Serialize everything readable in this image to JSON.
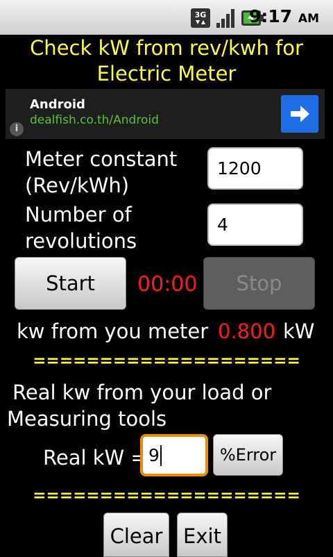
{
  "status": {
    "network": "3G",
    "time": "9:17",
    "ampm": "AM"
  },
  "title": {
    "line1": "Check kW from rev/kwh for",
    "line2": "Electric Meter"
  },
  "ad": {
    "name": "Android",
    "url": "dealfish.co.th/Android",
    "info": "i"
  },
  "form": {
    "meter_constant_label_1": "Meter constant",
    "meter_constant_label_2": "(Rev/kWh)",
    "meter_constant_value": "1200",
    "revolutions_label_1": "Number of",
    "revolutions_label_2": "revolutions",
    "revolutions_value": "4"
  },
  "controls": {
    "start": "Start",
    "stop": "Stop",
    "timer": "00:00"
  },
  "result": {
    "label": "kw from you meter",
    "value": "0.800",
    "unit": "kW"
  },
  "separator": "====================",
  "real": {
    "label_1": "Real kw from your load or",
    "label_2": "Measuring tools",
    "field_label": "Real kW =",
    "field_value": "9",
    "error_button": "%Error"
  },
  "footer": {
    "clear": "Clear",
    "exit": "Exit"
  },
  "colors": {
    "title": "#ffff33",
    "timer": "#ff1a1a",
    "result": "#ff1a1a",
    "focus": "#f08a00"
  }
}
